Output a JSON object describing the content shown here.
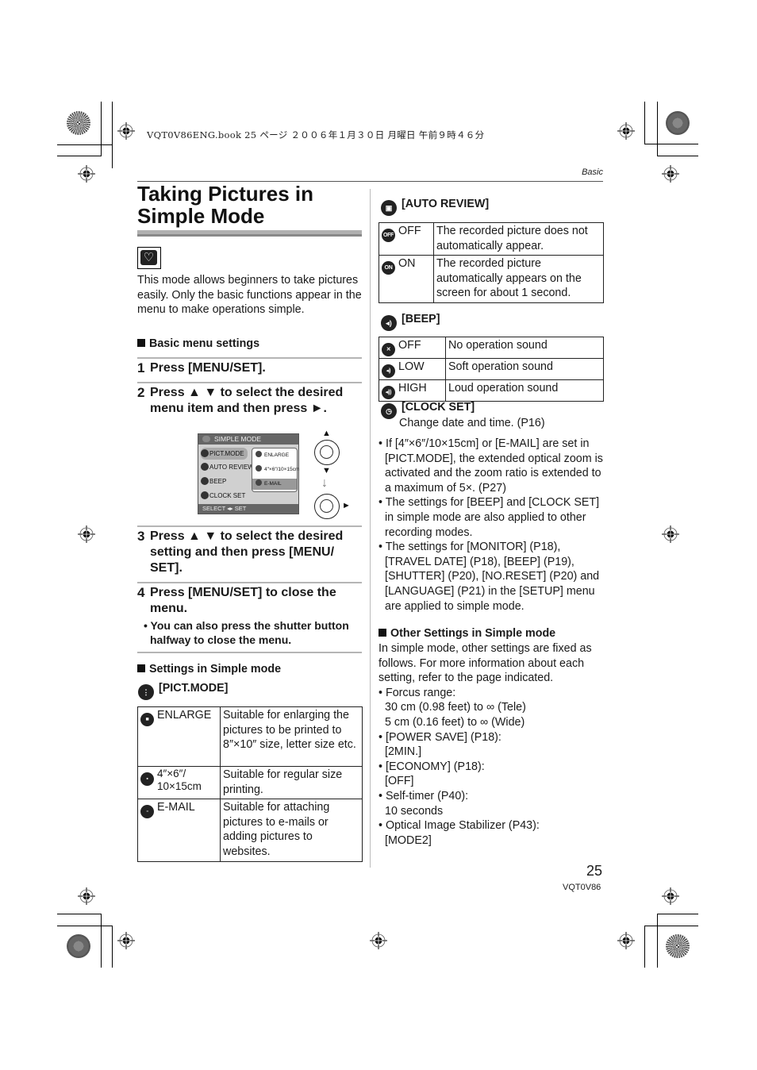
{
  "print_header": "VQT0V86ENG.book  25 ページ  ２００６年１月３０日  月曜日  午前９時４６分",
  "section_label": "Basic",
  "title_line1": "Taking Pictures in",
  "title_line2": "Simple Mode",
  "mode_icon": "heart-icon",
  "intro": "This mode allows beginners to take pictures easily. Only the basic functions appear in the menu to make operations simple.",
  "basic_menu_heading": "Basic menu settings",
  "steps": [
    {
      "num": "1",
      "text": "Press [MENU/SET]."
    },
    {
      "num": "2",
      "text": "Press ▲ ▼ to select the desired menu item and then press ►."
    },
    {
      "num": "3",
      "text": "Press ▲ ▼ to select the desired setting and then press [MENU/ SET]."
    },
    {
      "num": "4",
      "text": "Press [MENU/SET] to close the menu.",
      "note": "• You can also press the shutter button halfway to close the menu."
    }
  ],
  "lcd": {
    "title": "SIMPLE MODE",
    "items": [
      "PICT.MODE",
      "AUTO REVIEW",
      "BEEP",
      "CLOCK SET"
    ],
    "selected_item": "PICT.MODE",
    "popup_options": [
      "ENLARGE",
      "4″×6″/10×15cm",
      "E-MAIL"
    ],
    "selected_option": "E-MAIL",
    "footer": "SELECT ◂▸ SET",
    "footer_badge": "MENU SET"
  },
  "settings_heading": "Settings in Simple mode",
  "pict_mode": {
    "heading": "[PICT.MODE]",
    "rows": [
      {
        "icon": "enlarge-icon",
        "option": "ENLARGE",
        "desc": "Suitable for enlarging the pictures to be printed to 8″×10″ size, letter size etc."
      },
      {
        "icon": "print-size-icon",
        "option": "4″×6″/ 10×15cm",
        "desc": "Suitable for regular size printing."
      },
      {
        "icon": "email-icon",
        "option": "E-MAIL",
        "desc": "Suitable for attaching pictures to e-mails or adding pictures to websites."
      }
    ]
  },
  "auto_review": {
    "heading": "[AUTO REVIEW]",
    "rows": [
      {
        "icon": "off-icon",
        "badge": "OFF",
        "option": "OFF",
        "desc": "The recorded picture does not automatically appear."
      },
      {
        "icon": "on-icon",
        "badge": "ON",
        "option": "ON",
        "desc": "The recorded picture automatically appears on the screen for about 1 second."
      }
    ]
  },
  "beep": {
    "heading": "[BEEP]",
    "rows": [
      {
        "icon": "mute-icon",
        "option": "OFF",
        "desc": "No operation sound"
      },
      {
        "icon": "speaker-low-icon",
        "option": "LOW",
        "desc": "Soft operation sound"
      },
      {
        "icon": "speaker-high-icon",
        "option": "HIGH",
        "desc": "Loud operation sound"
      }
    ]
  },
  "clock_set": {
    "heading": "[CLOCK SET]",
    "desc": "Change date and time. (P16)"
  },
  "notes": [
    "If [4″×6″/10×15cm] or [E-MAIL] are set in [PICT.MODE], the extended optical zoom is activated and the zoom ratio is extended to a maximum of 5×. (P27)",
    "The settings for [BEEP] and [CLOCK SET] in simple mode are also applied to other recording modes.",
    "The settings for [MONITOR] (P18), [TRAVEL DATE] (P18), [BEEP] (P19), [SHUTTER] (P20),  [NO.RESET] (P20) and [LANGUAGE] (P21) in the [SETUP] menu are applied to simple mode."
  ],
  "other_settings": {
    "heading": "Other Settings in Simple mode",
    "intro": "In simple mode, other settings are fixed as follows. For more information about each setting, refer to the page indicated.",
    "items": [
      {
        "label": "Forcus range:",
        "values": [
          "30 cm (0.98 feet) to ∞ (Tele)",
          "5 cm (0.16 feet) to ∞ (Wide)"
        ]
      },
      {
        "label": "[POWER SAVE] (P18):",
        "values": [
          "[2MIN.]"
        ]
      },
      {
        "label": "[ECONOMY] (P18):",
        "values": [
          "[OFF]"
        ]
      },
      {
        "label": "Self-timer (P40):",
        "values": [
          "10 seconds"
        ]
      },
      {
        "label": "Optical Image Stabilizer (P43):",
        "values": [
          "[MODE2]"
        ]
      }
    ]
  },
  "page_number": "25",
  "page_code": "VQT0V86"
}
